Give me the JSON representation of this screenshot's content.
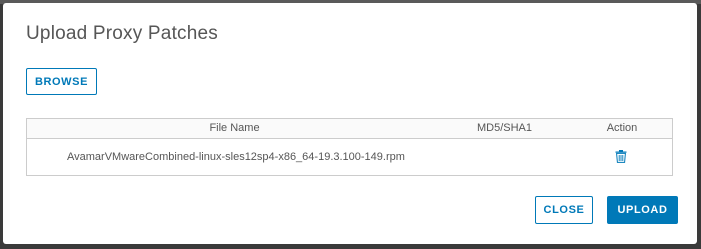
{
  "dialog": {
    "title": "Upload Proxy Patches",
    "browse_label": "BROWSE",
    "close_label": "CLOSE",
    "upload_label": "UPLOAD"
  },
  "table": {
    "columns": [
      "File Name",
      "MD5/SHA1",
      "Action"
    ],
    "rows": [
      {
        "file_name": "AvamarVMwareCombined-linux-sles12sp4-x86_64-19.3.100-149.rpm",
        "md5_sha1": "",
        "action_icon": "trash-icon"
      }
    ]
  },
  "colors": {
    "accent": "#0079b8",
    "text": "#565656",
    "border": "#cccccc"
  }
}
